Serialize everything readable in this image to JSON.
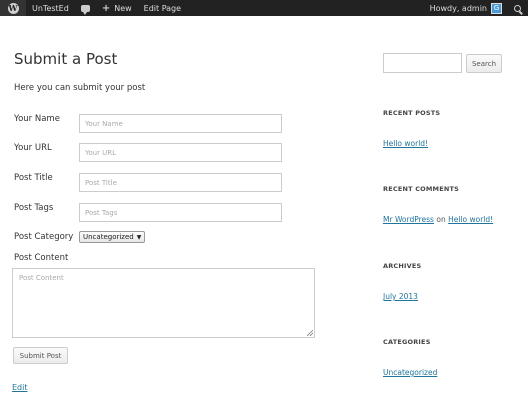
{
  "admin_bar": {
    "logo_glyph": "W",
    "site_name": "UnTestEd",
    "new_label": "New",
    "edit_page_label": "Edit Page",
    "howdy": "Howdy, admin",
    "avatar_glyph": "G"
  },
  "page": {
    "title": "Submit a Post",
    "intro": "Here you can submit your post"
  },
  "form": {
    "name_label": "Your Name",
    "name_placeholder": "Your Name",
    "url_label": "Your URL",
    "url_placeholder": "Your URL",
    "post_title_label": "Post Title",
    "post_title_placeholder": "Post Title",
    "post_tags_label": "Post Tags",
    "post_tags_placeholder": "Post Tags",
    "category_label": "Post Category",
    "category_value": "Uncategorized",
    "content_label": "Post Content",
    "content_placeholder": "Post Content",
    "submit_label": "Submit Post"
  },
  "footer": {
    "edit_link": "Edit"
  },
  "sidebar": {
    "search_button": "Search",
    "recent_posts_title": "RECENT POSTS",
    "recent_post_1": "Hello world!",
    "recent_comments_title": "RECENT COMMENTS",
    "comment_author": "Mr WordPress",
    "comment_on": "on",
    "comment_post": "Hello world!",
    "archives_title": "ARCHIVES",
    "archive_1": "July 2013",
    "categories_title": "CATEGORIES",
    "category_1": "Uncategorized"
  }
}
